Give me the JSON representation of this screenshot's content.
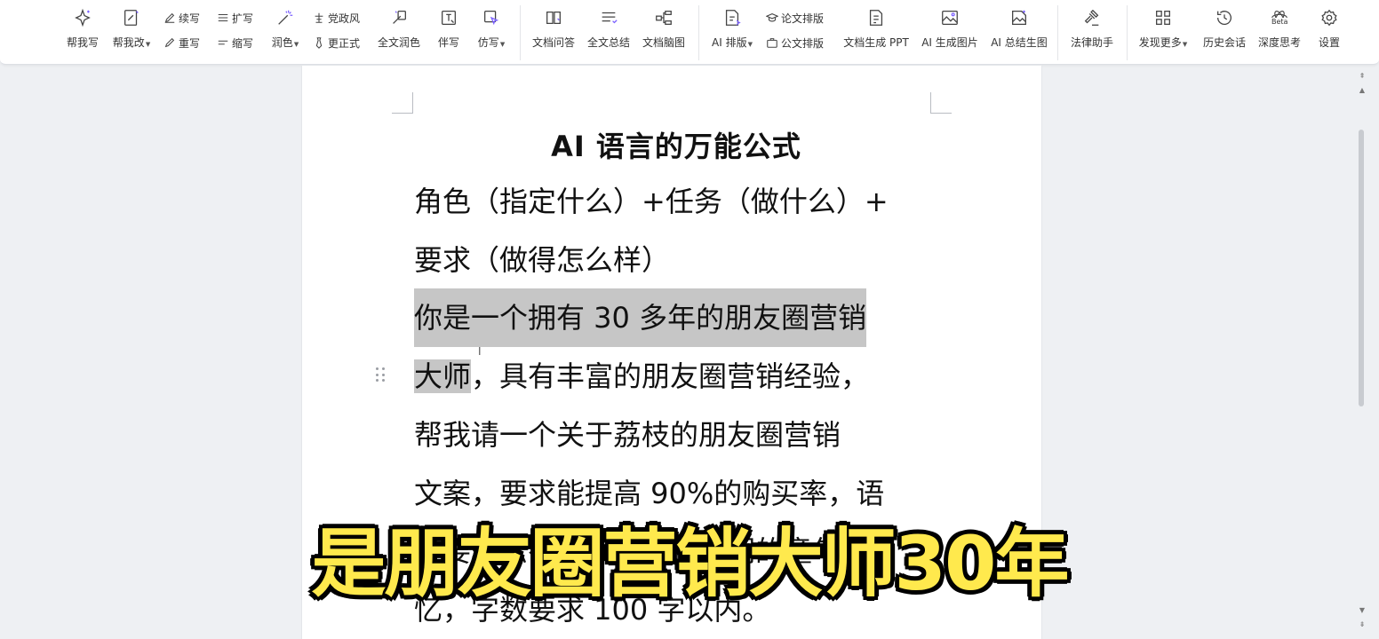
{
  "toolbar": {
    "help_write": "帮我写",
    "help_edit": "帮我改",
    "continue_write": "续写",
    "rewrite": "重写",
    "expand": "扩写",
    "condense": "缩写",
    "polish": "润色",
    "party_style": "党政风",
    "more_formal": "更正式",
    "full_polish": "全文润色",
    "companion_write": "伴写",
    "imitate_write": "仿写",
    "doc_qa": "文档问答",
    "full_summary": "全文总结",
    "doc_mindmap": "文档脑图",
    "ai_layout": "AI 排版",
    "paper_layout": "论文排版",
    "official_layout": "公文排版",
    "doc_to_ppt": "文档生成 PPT",
    "ai_image": "AI 生成图片",
    "ai_summary_image": "AI 总结生图",
    "legal_assistant": "法律助手",
    "discover_more": "发现更多",
    "history_chat": "历史会话",
    "deep_think": "深度思考",
    "deep_think_badge": "Beta",
    "settings": "设置"
  },
  "document": {
    "title": "AI 语言的万能公式",
    "lines": [
      "角色（指定什么）+任务（做什么）+",
      "要求（做得怎么样）",
      "你是一个拥有 30 多年的朋友圈营销",
      "大师",
      "，具有丰富的朋友圈营销经验，",
      "帮我请一个关于荔枝的朋友圈营销",
      "文案，要求能提高 90%的购买率，语",
      "言要轻松有趣，能唤起人们的童年回",
      "忆，字数要求 100 字以内。"
    ]
  },
  "subtitle": "是朋友圈营销大师30年",
  "colors": {
    "selection": "#c6c6c6",
    "subtitle_fill": "#ffe94d",
    "subtitle_outline": "#000000",
    "icon_accent": "#7b61ff"
  }
}
